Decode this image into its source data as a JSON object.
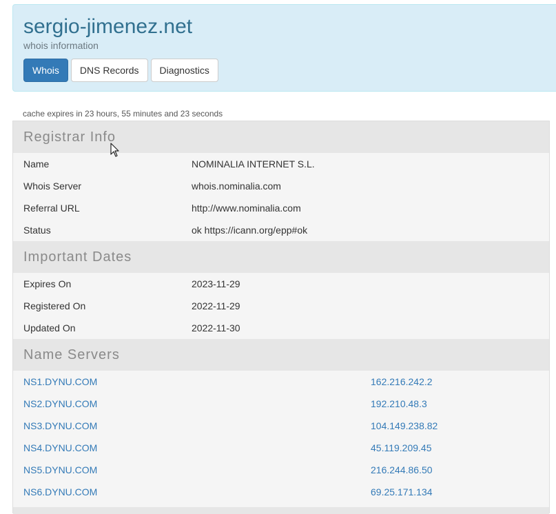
{
  "header": {
    "domain": "sergio-jimenez.net",
    "subtitle": "whois information",
    "tabs": [
      {
        "label": "Whois",
        "active": true
      },
      {
        "label": "DNS Records",
        "active": false
      },
      {
        "label": "Diagnostics",
        "active": false
      }
    ]
  },
  "cache_notice": "cache expires in 23 hours, 55 minutes and 23 seconds",
  "registrar": {
    "title": "Registrar Info",
    "rows": [
      {
        "key": "Name",
        "value": "NOMINALIA INTERNET S.L."
      },
      {
        "key": "Whois Server",
        "value": "whois.nominalia.com"
      },
      {
        "key": "Referral URL",
        "value": "http://www.nominalia.com"
      },
      {
        "key": "Status",
        "value": "ok https://icann.org/epp#ok"
      }
    ]
  },
  "dates": {
    "title": "Important Dates",
    "rows": [
      {
        "key": "Expires On",
        "value": "2023-11-29"
      },
      {
        "key": "Registered On",
        "value": "2022-11-29"
      },
      {
        "key": "Updated On",
        "value": "2022-11-30"
      }
    ]
  },
  "nameservers": {
    "title": "Name Servers",
    "rows": [
      {
        "host": "NS1.DYNU.COM",
        "ip": "162.216.242.2"
      },
      {
        "host": "NS2.DYNU.COM",
        "ip": "192.210.48.3"
      },
      {
        "host": "NS3.DYNU.COM",
        "ip": "104.149.238.82"
      },
      {
        "host": "NS4.DYNU.COM",
        "ip": "45.119.209.45"
      },
      {
        "host": "NS5.DYNU.COM",
        "ip": "216.244.86.50"
      },
      {
        "host": "NS6.DYNU.COM",
        "ip": "69.25.171.134"
      }
    ]
  },
  "colors": {
    "header_bg": "#d9edf7",
    "title": "#31708f",
    "accent": "#337ab7",
    "link": "#337ab7"
  },
  "icons": {
    "pointer": "mouse-pointer-icon"
  }
}
